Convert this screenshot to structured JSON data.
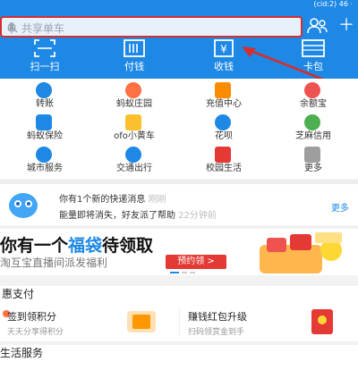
{
  "status": {
    "right": "(cid:2) 46 ·"
  },
  "search": {
    "placeholder": "共享单车"
  },
  "quick_actions": [
    {
      "label": "扫一扫",
      "icon": "scan-icon"
    },
    {
      "label": "付钱",
      "icon": "pay-code-icon"
    },
    {
      "label": "收钱",
      "icon": "receive-money-icon"
    },
    {
      "label": "卡包",
      "icon": "card-pack-icon"
    }
  ],
  "services": [
    {
      "label": "转账",
      "icon": "transfer-icon",
      "color": "#1e88e5"
    },
    {
      "label": "蚂蚁庄园",
      "icon": "chicken-icon",
      "color": "#ff7043"
    },
    {
      "label": "充值中心",
      "icon": "phone-icon",
      "color": "#fb8c00"
    },
    {
      "label": "余额宝",
      "icon": "yuebao-icon",
      "color": "#ef5350"
    },
    {
      "label": "蚂蚁保险",
      "icon": "insurance-icon",
      "color": "#1e88e5"
    },
    {
      "label": "ofo小黄车",
      "icon": "ofo-icon",
      "color": "#fbc02d"
    },
    {
      "label": "花呗",
      "icon": "huabei-icon",
      "color": "#1e88e5"
    },
    {
      "label": "芝麻信用",
      "icon": "sesame-icon",
      "color": "#4caf50"
    },
    {
      "label": "城市服务",
      "icon": "city-icon",
      "color": "#1e88e5"
    },
    {
      "label": "交通出行",
      "icon": "transport-icon",
      "color": "#1e88e5"
    },
    {
      "label": "校园生活",
      "icon": "campus-icon",
      "color": "#e53935"
    },
    {
      "label": "更多",
      "icon": "more-grid-icon",
      "color": "#9e9e9e"
    }
  ],
  "news": {
    "line1": "你有1个新的快递消息",
    "line1_tag": "刚刚",
    "line2": "能量即将消失，好友派了帮助",
    "line2_tag": "22分钟前",
    "more": "更多"
  },
  "banner": {
    "title_prefix": "你有一个",
    "title_highlight": "福袋",
    "title_suffix": "待领取",
    "subtitle": "淘互宝直播间派发福利",
    "cta": "预约领 >"
  },
  "pay_section": {
    "title": "惠支付",
    "left_title": "签到领积分",
    "left_sub": "天天分享得积分",
    "right_title": "赚钱红包升级",
    "right_sub": "扫码领赏金到手"
  },
  "life_section": {
    "title": "生活服务"
  },
  "colors": {
    "brand": "#1e88e5",
    "annotation": "#d32f2f",
    "cta": "#e53935"
  }
}
